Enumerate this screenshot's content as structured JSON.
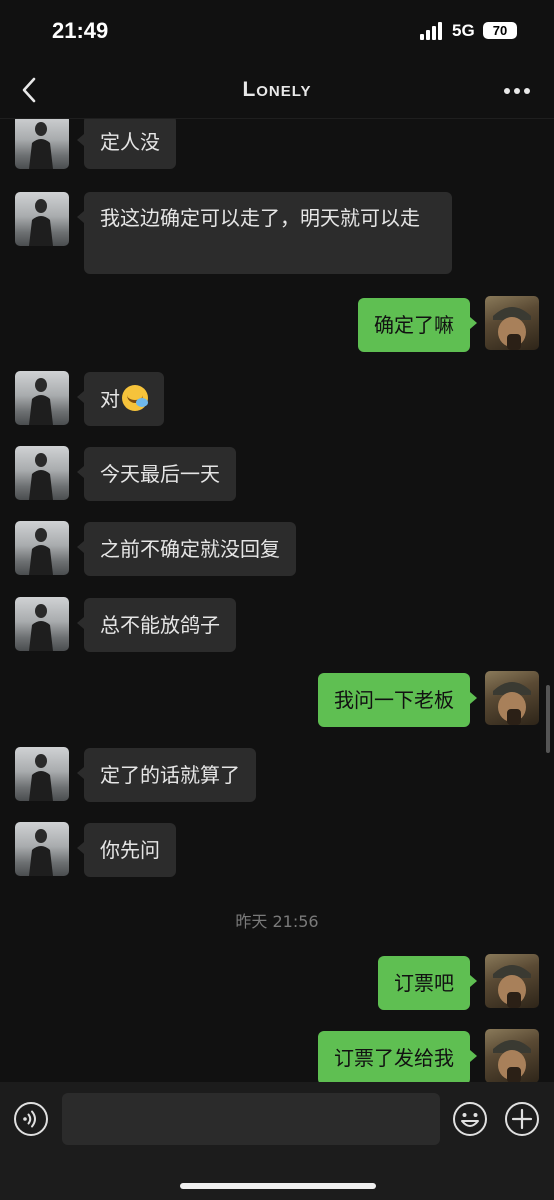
{
  "status_bar": {
    "time": "21:49",
    "network": "5G",
    "battery": "70"
  },
  "header": {
    "title": "Lonely",
    "back_icon": "chevron-left-icon",
    "more_icon": "more-dots-icon"
  },
  "messages": [
    {
      "from": "friend",
      "text": "定人没"
    },
    {
      "from": "friend",
      "text": "我这边确定可以走了，明天就可以走"
    },
    {
      "from": "me",
      "text": "确定了嘛"
    },
    {
      "from": "friend",
      "text": "对",
      "emoji": "laugh-cry-emoji"
    },
    {
      "from": "friend",
      "text": "今天最后一天"
    },
    {
      "from": "friend",
      "text": "之前不确定就没回复"
    },
    {
      "from": "friend",
      "text": "总不能放鸽子"
    },
    {
      "from": "me",
      "text": "我问一下老板"
    },
    {
      "from": "friend",
      "text": "定了的话就算了"
    },
    {
      "from": "friend",
      "text": "你先问"
    },
    {
      "from": "me",
      "text": "订票吧"
    },
    {
      "from": "me",
      "text": "订票了发给我"
    }
  ],
  "timestamp": "昨天 21:56",
  "input_bar": {
    "placeholder": "",
    "voice_icon": "voice-icon",
    "emoji_icon": "emoji-icon",
    "plus_icon": "plus-icon"
  },
  "colors": {
    "background": "#111111",
    "incoming_bubble": "#2c2c2c",
    "outgoing_bubble": "#5fbf52"
  }
}
